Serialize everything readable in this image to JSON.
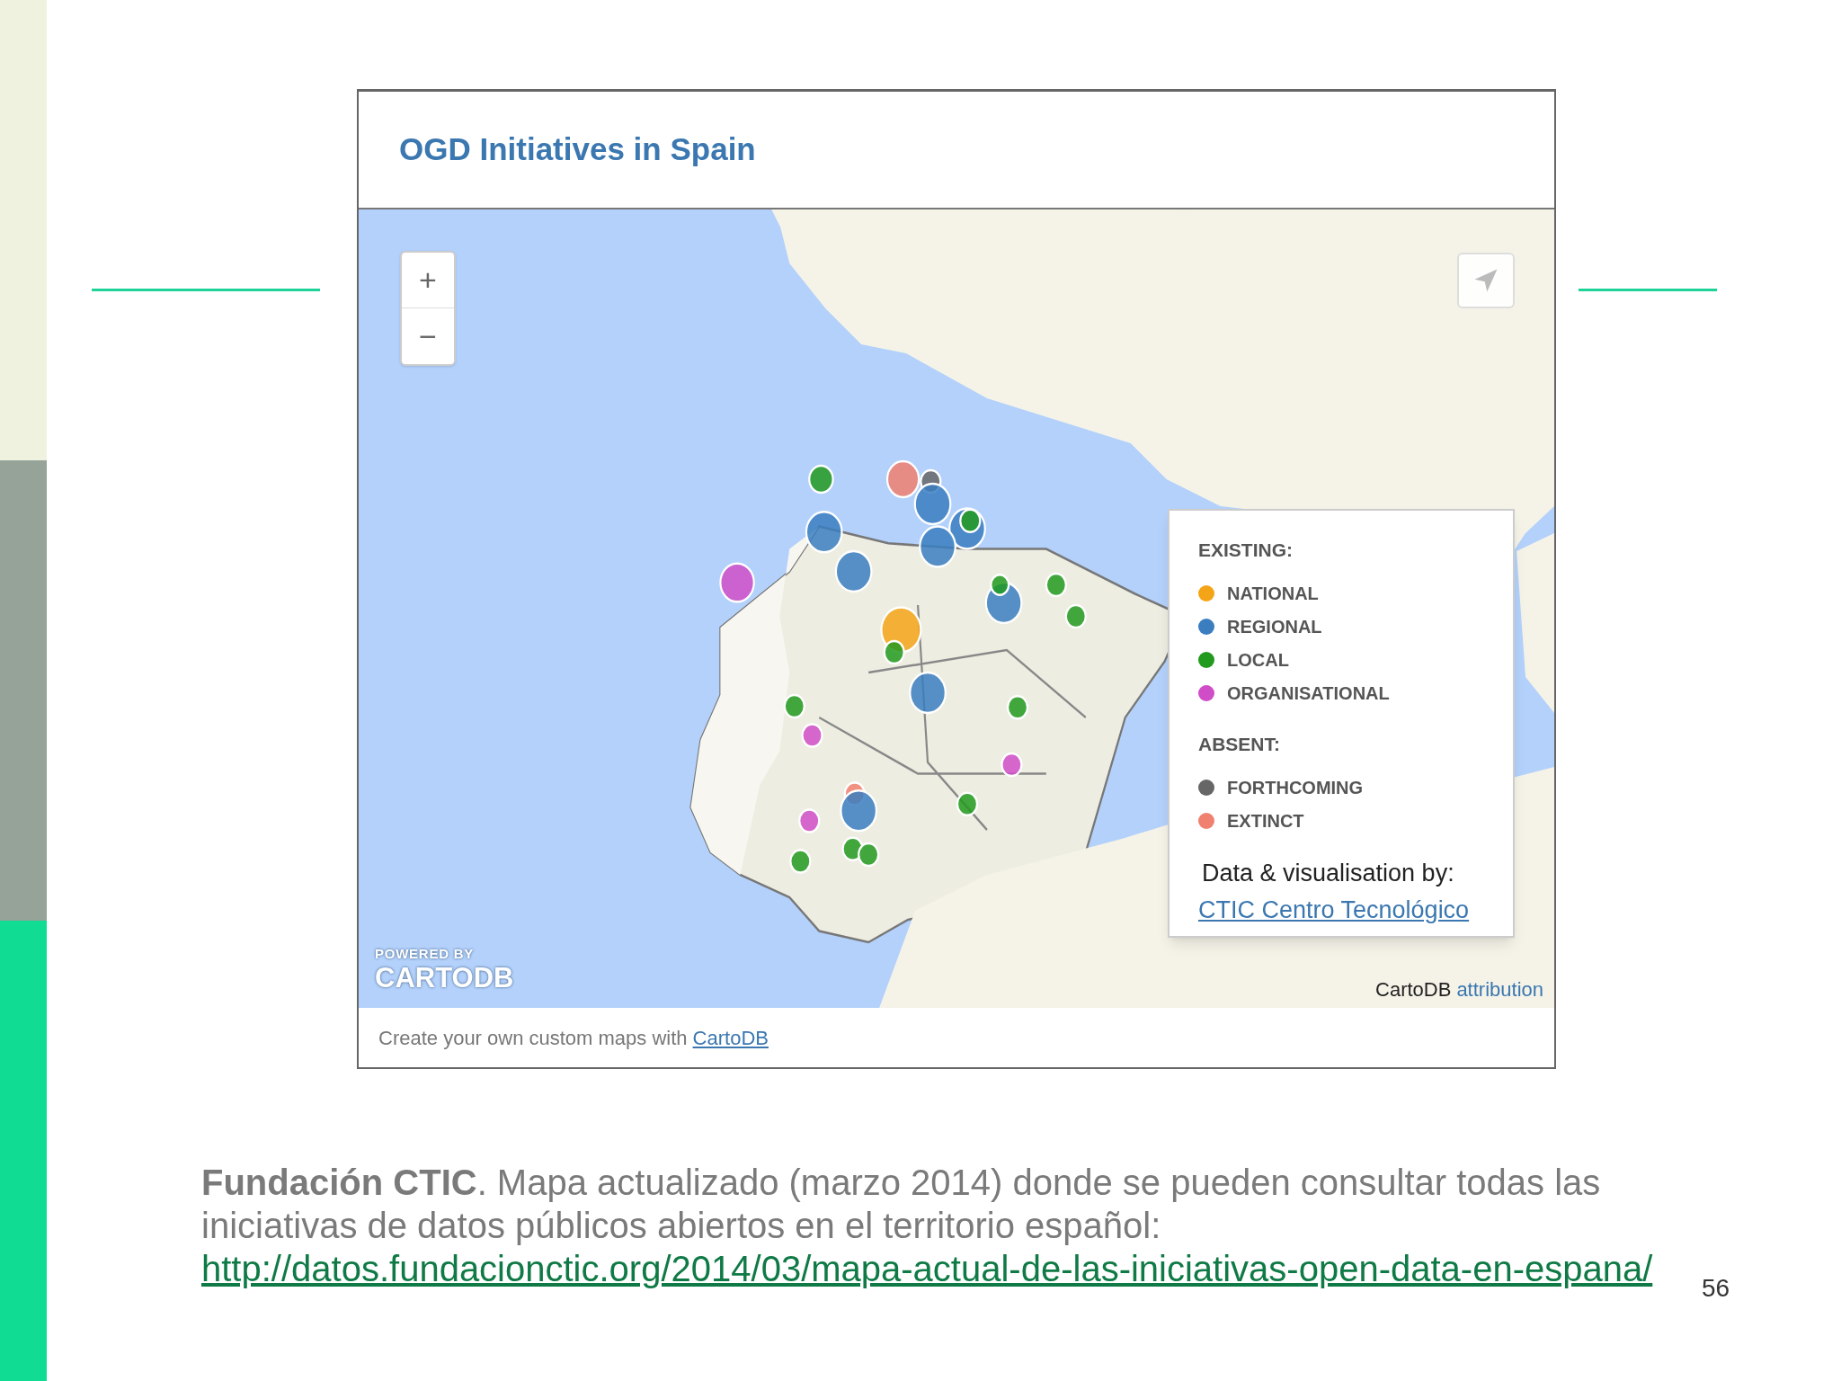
{
  "map_widget": {
    "title": "OGD Initiatives in Spain",
    "zoom_controls": [
      "+",
      "−"
    ],
    "legend": {
      "sections": [
        {
          "heading": "EXISTING:",
          "items": [
            {
              "label": "NATIONAL",
              "color": "#f4a417"
            },
            {
              "label": "REGIONAL",
              "color": "#3a7ebf"
            },
            {
              "label": "LOCAL",
              "color": "#229a1e"
            },
            {
              "label": "ORGANISATIONAL",
              "color": "#d04dc8"
            }
          ]
        },
        {
          "heading": "ABSENT:",
          "items": [
            {
              "label": "FORTHCOMING",
              "color": "#666666"
            },
            {
              "label": "EXTINCT",
              "color": "#f08070"
            }
          ]
        }
      ],
      "credit": "Data & visualisation by:",
      "credit_link": "CTIC Centro Tecnológico"
    },
    "watermark": {
      "small": "POWERED BY",
      "large": "CARTODB"
    },
    "attribution": {
      "text": "CartoDB",
      "link": "attribution"
    },
    "footer": {
      "text": "Create your own custom maps with",
      "link": "CartoDB"
    }
  },
  "caption": {
    "text": "**Fundación CTIC**. Mapa actualizado (marzo 2014) donde se pueden consultar todas las iniciativas de datos públicos abiertos en el territorio español:",
    "url": "http://datos.fundacionctic.org/2014/03/mapa-actual-de-las-iniciativas-open-data-en-espana/"
  },
  "page_number": "56"
}
